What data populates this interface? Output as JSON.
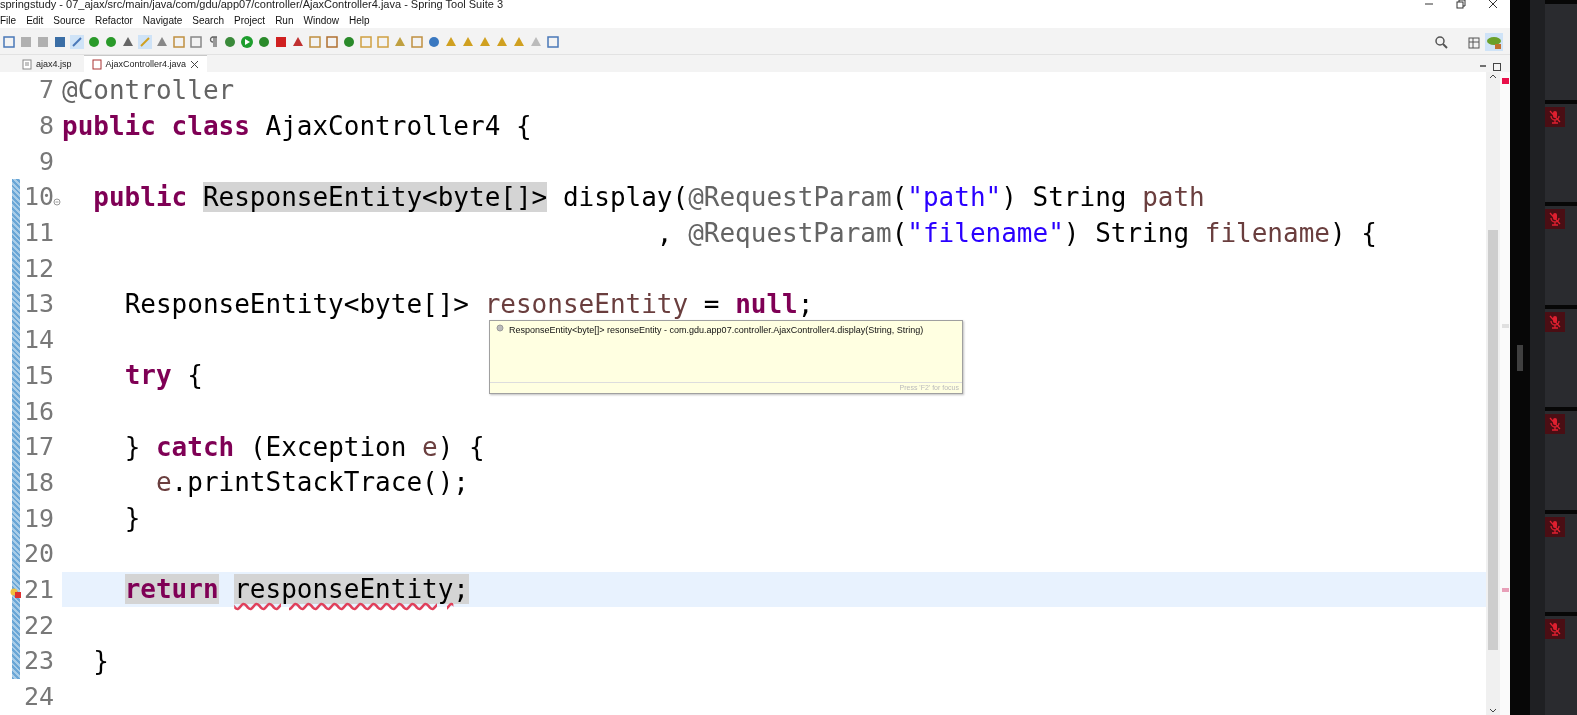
{
  "window": {
    "title": "springstudy - 07_ajax/src/main/java/com/gdu/app07/controller/AjaxController4.java - Spring Tool Suite 3"
  },
  "menu": [
    "File",
    "Edit",
    "Source",
    "Refactor",
    "Navigate",
    "Search",
    "Project",
    "Run",
    "Window",
    "Help"
  ],
  "tabs": [
    {
      "label": "ajax4.jsp",
      "kind": "jsp",
      "selected": false
    },
    {
      "label": "AjaxController4.java",
      "kind": "java",
      "selected": true
    }
  ],
  "editor": {
    "lines": [
      {
        "number": "7",
        "tokens": [
          {
            "text": "@Controller",
            "kind": "annotation"
          }
        ]
      },
      {
        "number": "8",
        "tokens": [
          {
            "text": "public class",
            "kind": "keyword"
          },
          {
            "text": " AjaxController4 {",
            "kind": "plain"
          }
        ]
      },
      {
        "number": "9"
      },
      {
        "number": "10",
        "fold": true,
        "tokens": [
          {
            "text": "  public ",
            "kind": "keyword"
          },
          {
            "text": "ResponseEntity<byte[]>",
            "kind": "plain",
            "occurrence": true
          },
          {
            "text": " display(",
            "kind": "plain"
          },
          {
            "text": "@RequestParam",
            "kind": "annotation"
          },
          {
            "text": "(",
            "kind": "plain"
          },
          {
            "text": "\"path\"",
            "kind": "string"
          },
          {
            "text": ") String ",
            "kind": "plain"
          },
          {
            "text": "path",
            "kind": "param"
          }
        ]
      },
      {
        "number": "11",
        "tokens": [
          {
            "text": "                                      , ",
            "kind": "plain"
          },
          {
            "text": "@RequestParam",
            "kind": "annotation"
          },
          {
            "text": "(",
            "kind": "plain"
          },
          {
            "text": "\"filename\"",
            "kind": "string"
          },
          {
            "text": ") String ",
            "kind": "plain"
          },
          {
            "text": "filename",
            "kind": "param"
          },
          {
            "text": ") {",
            "kind": "plain"
          }
        ]
      },
      {
        "number": "12"
      },
      {
        "number": "13",
        "tokens": [
          {
            "text": "    ResponseEntity<byte[]> ",
            "kind": "plain"
          },
          {
            "text": "resonseEntity",
            "kind": "param"
          },
          {
            "text": " = ",
            "kind": "plain"
          },
          {
            "text": "null",
            "kind": "keyword"
          },
          {
            "text": ";",
            "kind": "plain"
          }
        ]
      },
      {
        "number": "14"
      },
      {
        "number": "15",
        "tokens": [
          {
            "text": "    try",
            "kind": "keyword"
          },
          {
            "text": " {",
            "kind": "plain"
          }
        ]
      },
      {
        "number": "16"
      },
      {
        "number": "17",
        "tokens": [
          {
            "text": "    } ",
            "kind": "plain"
          },
          {
            "text": "catch",
            "kind": "keyword"
          },
          {
            "text": " (Exception ",
            "kind": "plain"
          },
          {
            "text": "e",
            "kind": "param"
          },
          {
            "text": ") {",
            "kind": "plain"
          }
        ]
      },
      {
        "number": "18",
        "tokens": [
          {
            "text": "      e",
            "kind": "param"
          },
          {
            "text": ".printStackTrace();",
            "kind": "plain"
          }
        ]
      },
      {
        "number": "19",
        "tokens": [
          {
            "text": "    }",
            "kind": "plain"
          }
        ]
      },
      {
        "number": "20"
      },
      {
        "number": "21",
        "current": true,
        "error": true,
        "tokens": [
          {
            "text": "    return",
            "kind": "keyword",
            "occurrence": true
          },
          {
            "text": " responseEntity",
            "kind": "plain",
            "occurrence": true,
            "squiggle": true
          },
          {
            "text": ";",
            "kind": "plain",
            "occurrence": true
          }
        ]
      },
      {
        "number": "22"
      },
      {
        "number": "23",
        "tokens": [
          {
            "text": "  }",
            "kind": "plain"
          }
        ]
      },
      {
        "number": "24"
      }
    ]
  },
  "hover": {
    "text": "ResponseEntity<byte[]> resonseEntity - com.gdu.app07.controller.AjaxController4.display(String, String)",
    "footer": "Press 'F2' for focus"
  }
}
